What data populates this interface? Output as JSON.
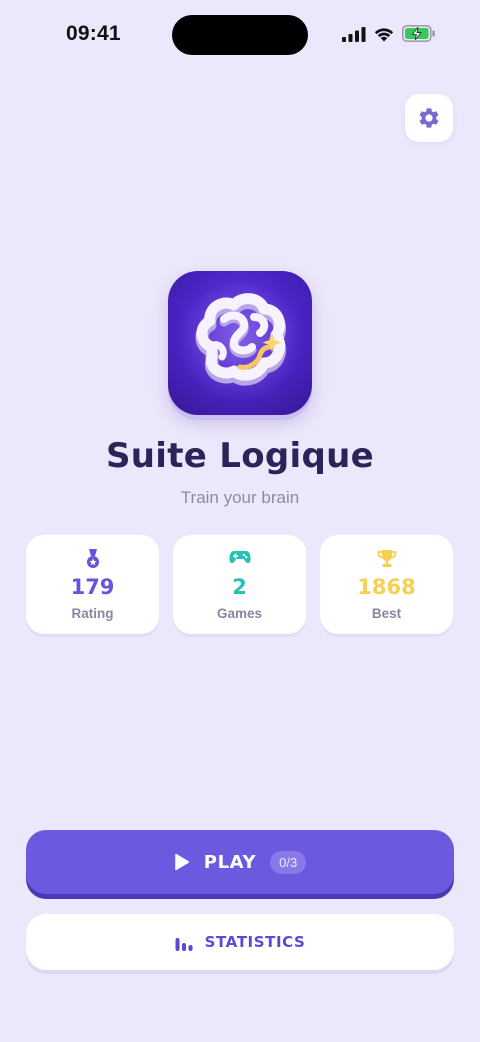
{
  "status_bar": {
    "time": "09:41"
  },
  "app": {
    "title": "Suite Logique",
    "subtitle": "Train your brain"
  },
  "stats": [
    {
      "icon": "medal-icon",
      "value": "179",
      "label": "Rating",
      "color": "#6a52dc"
    },
    {
      "icon": "gamepad-icon",
      "value": "2",
      "label": "Games",
      "color": "#27c1b3"
    },
    {
      "icon": "trophy-icon",
      "value": "1868",
      "label": "Best",
      "color": "#f6cf55"
    }
  ],
  "play": {
    "label": "PLAY",
    "badge": "0/3"
  },
  "statistics": {
    "label": "STATISTICS"
  },
  "colors": {
    "background": "#ece8fb",
    "primary": "#6b59e0",
    "title": "#2b2459"
  }
}
